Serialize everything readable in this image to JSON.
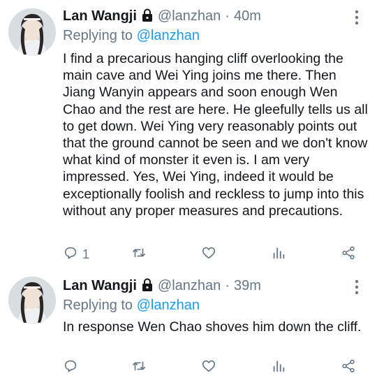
{
  "tweets": [
    {
      "author_name": "Lan Wangji",
      "handle": "@lanzhan",
      "separator": "·",
      "time": "40m",
      "replying_prefix": "Replying to",
      "replying_handle": "@lanzhan",
      "text": "I find a precarious hanging cliff overlooking the main cave and Wei Ying joins me there. Then Jiang Wanyin appears and soon enough Wen Chao and the rest are here. He gleefully tells us all to get down. Wei Ying very reasonably points out that the ground cannot be seen and we don't know what kind of monster it even is. I am very impressed. Yes, Wei Ying, indeed it would be exceptionally foolish and reckless to jump into this without any proper measures and precautions.",
      "reply_count": "1"
    },
    {
      "author_name": "Lan Wangji",
      "handle": "@lanzhan",
      "separator": "·",
      "time": "39m",
      "replying_prefix": "Replying to",
      "replying_handle": "@lanzhan",
      "text": "In response Wen Chao shoves him down the cliff.",
      "reply_count": ""
    }
  ],
  "icons": {
    "lock": "lock-icon",
    "more": "more-icon",
    "reply": "reply-icon",
    "retweet": "retweet-icon",
    "like": "heart-icon",
    "stats": "stats-icon",
    "share": "share-icon"
  },
  "colors": {
    "text": "#14171a",
    "muted": "#657786",
    "link": "#1d9bf0"
  }
}
